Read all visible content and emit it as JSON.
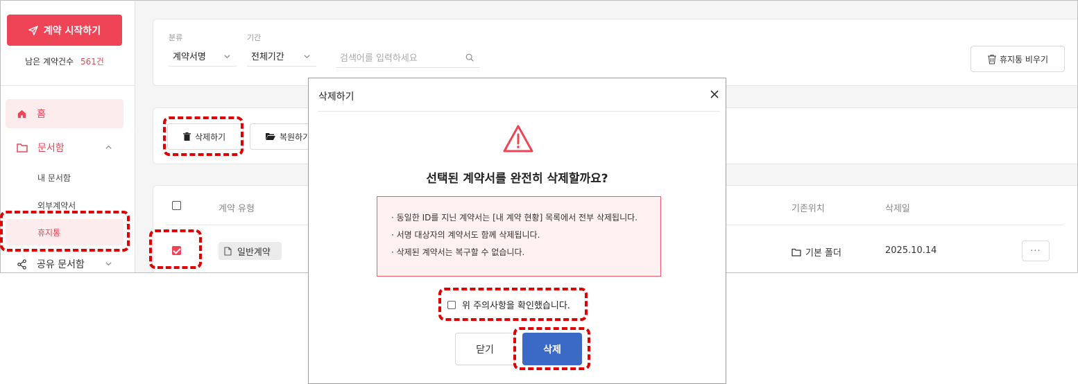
{
  "sidebar": {
    "start_button": "계약 시작하기",
    "remaining_label": "남은 계약건수",
    "remaining_count": "561건",
    "nav_home": "홈",
    "nav_documents": "문서함",
    "sub_my_documents": "내 문서함",
    "sub_external": "외부계약서",
    "sub_trash": "휴지통",
    "nav_shared": "공유 문서함"
  },
  "filters": {
    "category_label": "분류",
    "category_value": "계약서명",
    "period_label": "기간",
    "period_value": "전체기간",
    "search_placeholder": "검색어를 입력하세요",
    "empty_trash_button": "휴지통 비우기"
  },
  "actions": {
    "delete_button": "삭제하기",
    "restore_button": "복원하기"
  },
  "table": {
    "columns": {
      "type": "계약 유형",
      "original_location": "기존위치",
      "deleted_date": "삭제일"
    },
    "rows": [
      {
        "checked": true,
        "type": "일반계약",
        "location": "기본 폴더",
        "deleted_date": "2025.10.14",
        "more": "···"
      }
    ]
  },
  "modal": {
    "title": "삭제하기",
    "heading": "선택된 계약서를 완전히 삭제할까요?",
    "notices": [
      "· 동일한 ID를 지닌 계약서는 [내 계약 현황] 목록에서 전부 삭제됩니다.",
      "· 서명 대상자의 계약서도 함께 삭제됩니다.",
      "· 삭제된 계약서는 복구할 수 없습니다."
    ],
    "confirm_label": "위 주의사항을 확인했습니다.",
    "close_button": "닫기",
    "delete_button": "삭제"
  },
  "colors": {
    "accent": "#ef4356",
    "primary_button": "#3a6ac6",
    "highlight": "#e00000"
  }
}
